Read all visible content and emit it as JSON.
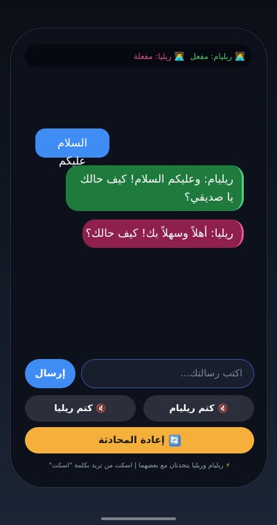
{
  "status": {
    "rilyam": {
      "icon": "laptop-person-icon",
      "emoji": "🧑‍💻",
      "text": "ريليام: مفعل"
    },
    "rilia": {
      "icon": "woman-technologist-icon",
      "emoji": "👩‍💻",
      "text": "ريليا: مفعلة"
    }
  },
  "messages": [
    {
      "sender": "user",
      "text": "السلام عليكم",
      "color": "#3f8cf4"
    },
    {
      "sender": "rilyam",
      "text": "ريليام: وعليكم السلام! كيف حالك يا صديقي؟",
      "color": "#1e7a3d"
    },
    {
      "sender": "rilia",
      "text": "ريليا: أهلاً وسهلاً بك! كيف حالك؟",
      "color": "#8f1f4d"
    }
  ],
  "composer": {
    "placeholder": "اكتب رسالتك...",
    "value": "",
    "send_label": "إرسال"
  },
  "controls": {
    "mute_rilyam_label": "كتم ريليام",
    "mute_rilia_label": "كتم ريليا",
    "mute_icon": "🔇",
    "reset_label": "إعادة المحادثة",
    "reset_icon": "🔄"
  },
  "footer": {
    "bolt": "⚡",
    "note": "ريليام وريليا يتحدثان مع بعضهما | اسكت من تريد بكلمة \"اسكت\""
  },
  "colors": {
    "accent_blue": "#3f8cf4",
    "rilyam_green": "#1e7a3d",
    "rilia_pink": "#8f1f4d",
    "reset_orange": "#f5b03c"
  }
}
